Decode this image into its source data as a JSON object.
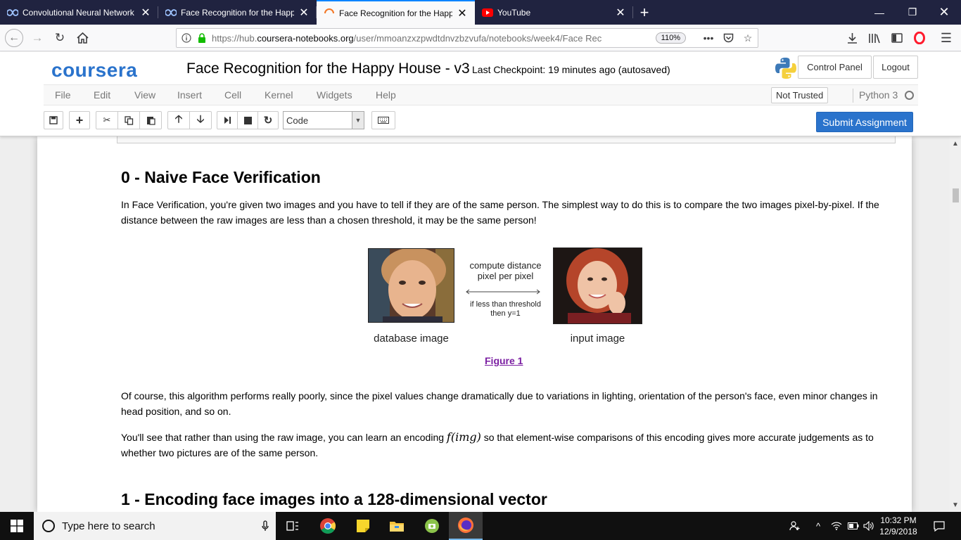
{
  "browser": {
    "tabs": [
      {
        "title": "Convolutional Neural Network",
        "icon": "coursera-infinity-icon"
      },
      {
        "title": "Face Recognition for the Happy",
        "icon": "coursera-infinity-icon"
      },
      {
        "title": "Face Recognition for the Happy",
        "icon": "jupyter-loading-icon",
        "active": true
      },
      {
        "title": "YouTube",
        "icon": "youtube-icon"
      }
    ],
    "url_prefix": "https://hub.",
    "url_domain": "coursera-notebooks.org",
    "url_rest": "/user/mmoanzxzpwdtdnvzbzvufa/notebooks/week4/Face Rec",
    "zoom": "110%"
  },
  "notebook": {
    "logo": "coursera",
    "title": "Face Recognition for the Happy House - v3",
    "checkpoint": "Last Checkpoint: 19 minutes ago (autosaved)",
    "control_panel": "Control Panel",
    "logout": "Logout",
    "menu": [
      "File",
      "Edit",
      "View",
      "Insert",
      "Cell",
      "Kernel",
      "Widgets",
      "Help"
    ],
    "trust": "Not Trusted",
    "kernel": "Python 3",
    "cell_type": "Code",
    "submit": "Submit Assignment"
  },
  "content": {
    "heading0": "0 - Naive Face Verification",
    "para1": "In Face Verification, you're given two images and you have to tell if they are of the same person. The simplest way to do this is to compare the two images pixel-by-pixel. If the distance between the raw images are less than a chosen threshold, it may be the same person!",
    "figure": {
      "compute1": "compute distance",
      "compute2": "pixel per pixel",
      "threshold1": "if less than threshold",
      "threshold2": "then y=1",
      "left_label": "database image",
      "right_label": "input image",
      "caption": "Figure 1"
    },
    "para2": "Of course, this algorithm performs really poorly, since the pixel values change dramatically due to variations in lighting, orientation of the person's face, even minor changes in head position, and so on.",
    "para3_before": "You'll see that rather than using the raw image, you can learn an encoding ",
    "para3_math": "f(img)",
    "para3_after": " so that element-wise comparisons of this encoding gives more accurate judgements as to whether two pictures are of the same person.",
    "heading1": "1 - Encoding face images into a 128-dimensional vector"
  },
  "taskbar": {
    "search_placeholder": "Type here to search",
    "time": "10:32 PM",
    "date": "12/9/2018"
  },
  "colors": {
    "coursera_blue": "#2a73cc",
    "tab_bar": "#202340",
    "figure_caption": "#7b1fa2"
  }
}
